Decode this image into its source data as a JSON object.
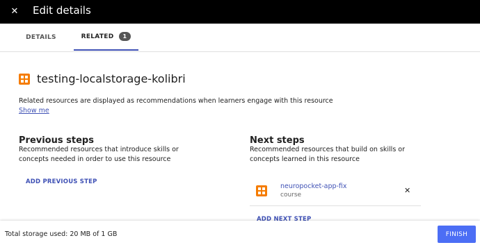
{
  "header": {
    "close_icon": "close-icon",
    "title": "Edit details"
  },
  "tabs": [
    {
      "label": "DETAILS"
    },
    {
      "label": "RELATED",
      "badge": "1"
    }
  ],
  "resource": {
    "title": "testing-localstorage-kolibri",
    "icon": "course-grid-icon",
    "icon_color": "#f57c00"
  },
  "description": "Related resources are displayed as recommendations when learners engage with this resource",
  "show_me": "Show me",
  "previous": {
    "title": "Previous steps",
    "description": "Recommended resources that introduce skills or concepts needed in order to use this resource",
    "action": "ADD PREVIOUS STEP"
  },
  "next": {
    "title": "Next steps",
    "description": "Recommended resources that build on skills or concepts learned in this resource",
    "items": [
      {
        "name": "neuropocket-app-fix",
        "kind": "course"
      }
    ],
    "action": "ADD NEXT STEP"
  },
  "footer": {
    "storage": "Total storage used: 20 MB of 1 GB",
    "finish": "FINISH"
  },
  "colors": {
    "accent": "#3f51b5",
    "finish": "#4c6ef5",
    "topbar": "#000000"
  }
}
